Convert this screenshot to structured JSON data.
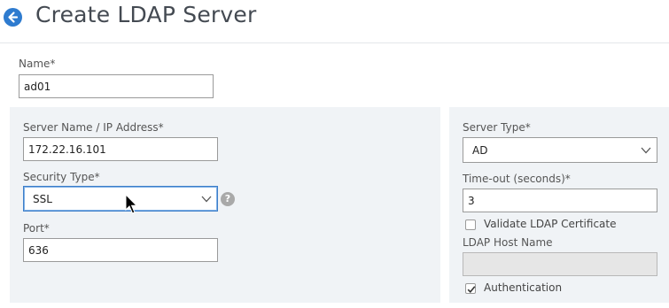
{
  "header": {
    "title": "Create LDAP Server",
    "back_icon": "arrow-left-circle-icon",
    "accent_color": "#2e7bcf"
  },
  "form": {
    "name": {
      "label": "Name*",
      "value": "ad01"
    },
    "server_name": {
      "label": "Server Name / IP Address*",
      "value": "172.22.16.101"
    },
    "security_type": {
      "label": "Security Type*",
      "selected": "SSL",
      "help": "?"
    },
    "port": {
      "label": "Port*",
      "value": "636"
    },
    "server_type": {
      "label": "Server Type*",
      "selected": "AD"
    },
    "timeout": {
      "label": "Time-out (seconds)*",
      "value": "3"
    },
    "validate_cert": {
      "label": "Validate LDAP Certificate",
      "checked": false
    },
    "ldap_host_name": {
      "label": "LDAP Host Name",
      "value": ""
    },
    "authentication": {
      "label": "Authentication",
      "checked": true
    }
  }
}
